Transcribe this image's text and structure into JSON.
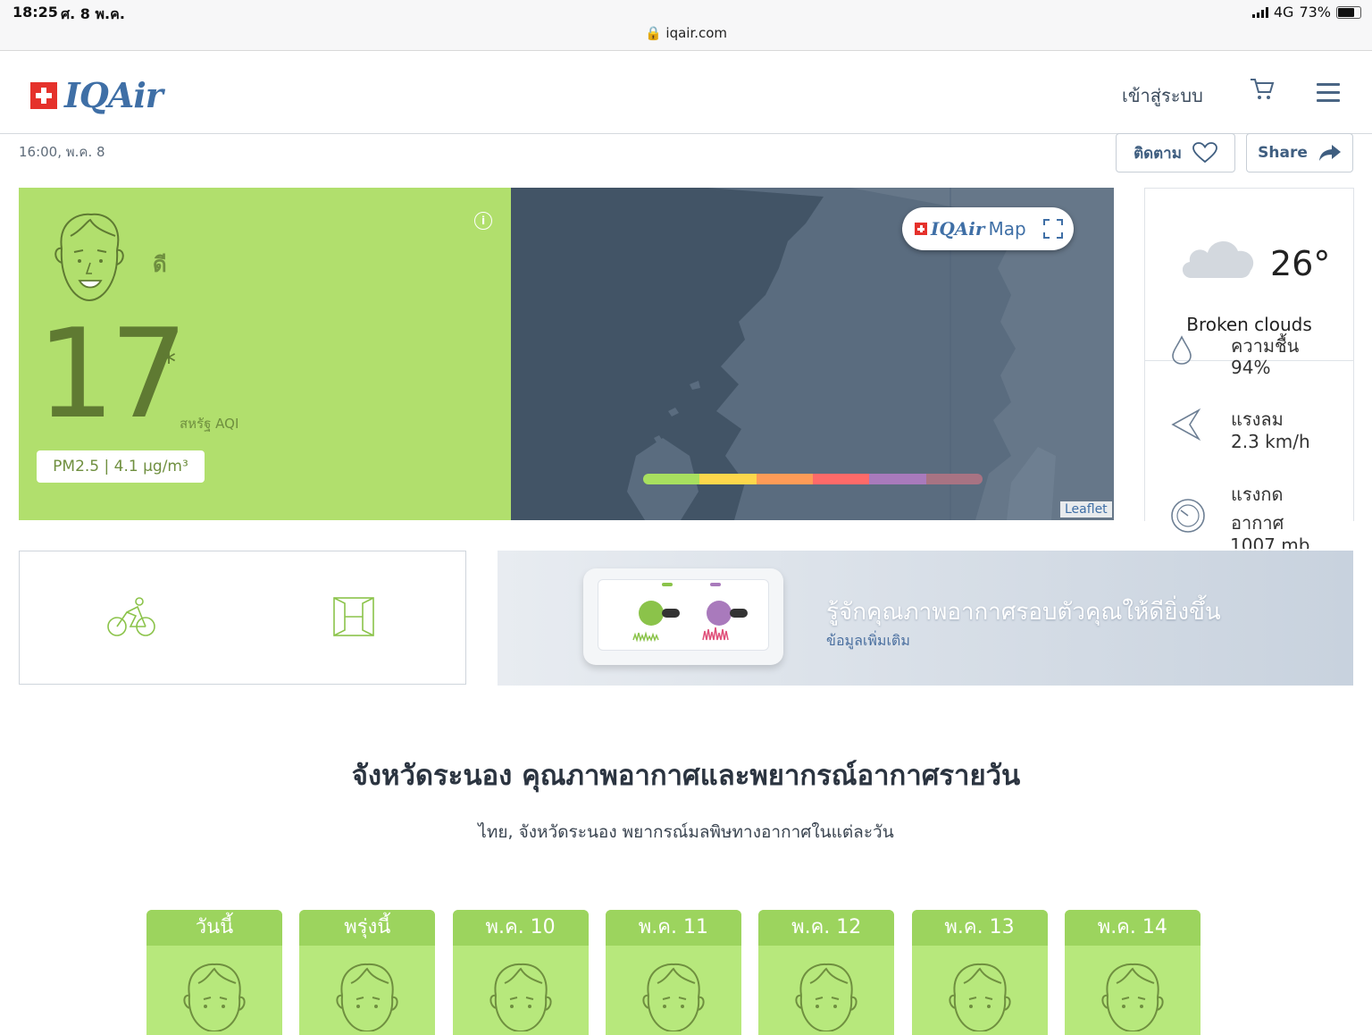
{
  "statusbar": {
    "time": "18:25",
    "date": "ศ. 8 พ.ค.",
    "network": "4G",
    "battery": "73%",
    "url": "iqair.com"
  },
  "header": {
    "logo": "IQAir",
    "login": "เข้าสู่ระบบ",
    "cart_icon": "cart-icon",
    "menu_icon": "hamburger-icon"
  },
  "updated": "16:00, พ.ค. 8",
  "actions": {
    "follow": "ติดตาม",
    "share": "Share"
  },
  "aqi": {
    "status": "ดี",
    "value": "17",
    "star": "*",
    "unit": "สหรัฐ AQI",
    "pm": "PM2.5 | 4.1 µg/m³",
    "color": "#b1df6d"
  },
  "map": {
    "badge_logo": "IQAir",
    "badge_map": "Map",
    "attribution": "Leaflet",
    "scale_colors": [
      "#a8e05f",
      "#fdd74b",
      "#fe9b57",
      "#fe6a69",
      "#a97abc",
      "#a87383"
    ]
  },
  "weather": {
    "temp": "26°",
    "condition": "Broken clouds",
    "humidity_label": "ความชื้น",
    "humidity": "94%",
    "wind_label": "แรงลม",
    "wind": "2.3 km/h",
    "pressure_label_1": "แรงกด",
    "pressure_label_2": "อากาศ",
    "pressure": "1007 mb"
  },
  "promo": {
    "title": "รู้จักคุณภาพอากาศรอบตัวคุณให้ดียิ่งขึ้น",
    "link": "ข้อมูลเพิ่มเติม"
  },
  "section": {
    "title": "จังหวัดระนอง คุณภาพอากาศและพยากรณ์อากาศรายวัน",
    "subtitle": "ไทย, จังหวัดระนอง พยากรณ์มลพิษทางอากาศในแต่ละวัน"
  },
  "forecast": [
    {
      "day": "วันนี้"
    },
    {
      "day": "พรุ่งนี้"
    },
    {
      "day": "พ.ค. 10"
    },
    {
      "day": "พ.ค. 11"
    },
    {
      "day": "พ.ค. 12"
    },
    {
      "day": "พ.ค. 13"
    },
    {
      "day": "พ.ค. 14"
    }
  ]
}
